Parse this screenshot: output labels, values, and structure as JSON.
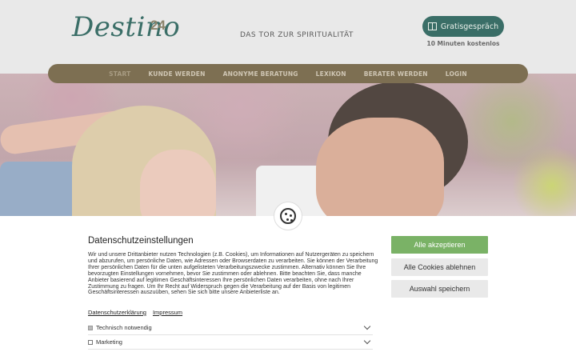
{
  "header": {
    "logo_text": "Destino",
    "logo_sup": "24",
    "tagline": "DAS TOR ZUR SPIRITUALITÄT",
    "cta_label": "Gratisgespräch",
    "cta_sub": "10 Minuten kostenlos",
    "brand_color": "#1f5a52"
  },
  "nav": {
    "items": [
      {
        "label": "START"
      },
      {
        "label": "KUNDE WERDEN"
      },
      {
        "label": "ANONYME BERATUNG"
      },
      {
        "label": "LEXIKON"
      },
      {
        "label": "BERATER WERDEN"
      },
      {
        "label": "LOGIN"
      }
    ],
    "bar_color": "#7d6f52"
  },
  "cookie": {
    "title": "Datenschutzeinstellungen",
    "text": "Wir und unsere Drittanbieter nutzen Technologien (z.B. Cookies), um Informationen auf Nutzergeräten zu speichern und abzurufen, um persönliche Daten, wie Adressen oder Browserdaten zu verarbeiten. Sie können der Verarbeitung Ihrer persönlichen Daten für die unten aufgelisteten Verarbeitungszwecke zustimmen. Alternativ können Sie Ihre bevorzugten Einstellungen vornehmen, bevor Sie zustimmen oder ablehnen. Bitte beachten Sie, dass manche Anbieter basierend auf legitimen Geschäftsinteressen Ihre persönlichen Daten verarbeiten, ohne nach Ihrer Zustimmung zu fragen. Um Ihr Recht auf Widerspruch gegen die Verarbeitung auf der Basis von legitimen Geschäftsinteressen auszuüben, sehen Sie sich bitte unsere Anbieterliste an.",
    "link_privacy": "Datenschutzerklärung",
    "link_imprint": "Impressum",
    "options": [
      {
        "label": "Technisch notwendig",
        "checked": true
      },
      {
        "label": "Marketing",
        "checked": false
      }
    ],
    "btn_accept": "Alle akzeptieren",
    "btn_reject": "Alle Cookies ablehnen",
    "btn_save": "Auswahl speichern",
    "accept_color": "#7ab266"
  }
}
